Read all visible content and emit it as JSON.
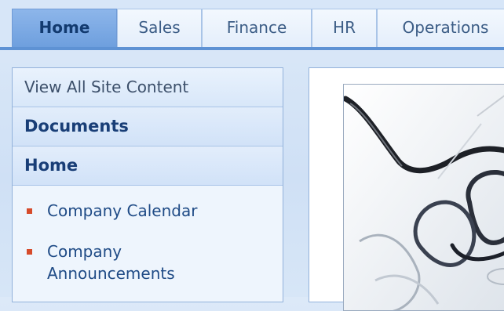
{
  "tabs": [
    {
      "label": "Home",
      "active": true
    },
    {
      "label": "Sales",
      "active": false
    },
    {
      "label": "Finance",
      "active": false
    },
    {
      "label": "HR",
      "active": false
    },
    {
      "label": "Operations",
      "active": false
    }
  ],
  "quick_launch": {
    "view_all": "View All Site Content",
    "headers": [
      "Documents",
      "Home"
    ],
    "items": [
      "Company Calendar",
      "Company",
      "Announcements"
    ]
  },
  "content": {
    "image_icon": "eyeglasses-photo"
  },
  "colors": {
    "active_tab": "#7aa9e4",
    "tab_rule": "#5e92d4",
    "bullet": "#d64b2b",
    "link": "#1f4b86"
  }
}
